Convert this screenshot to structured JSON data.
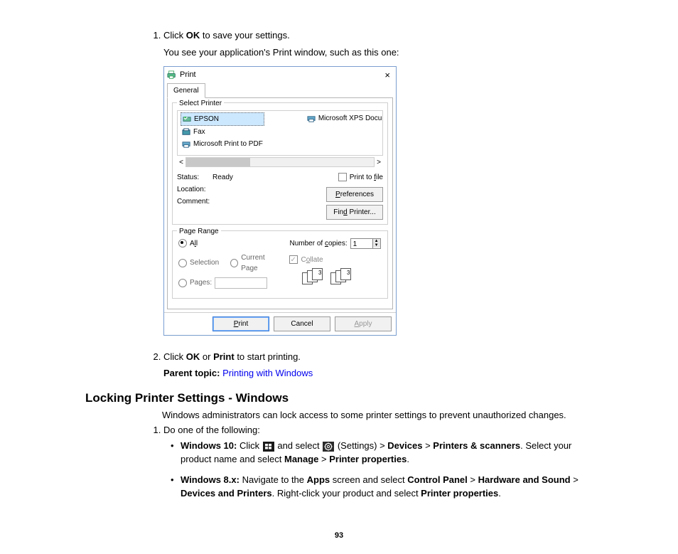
{
  "step1": {
    "num": "1.",
    "text_before": "Click ",
    "text_bold": "OK",
    "text_after": " to save your settings.",
    "subtext": "You see your application's Print window, such as this one:"
  },
  "dialog": {
    "title": "Print",
    "close": "×",
    "tab": "General",
    "group_select": "Select Printer",
    "printers": {
      "p0": "EPSON",
      "p1": "Fax",
      "p2": "Microsoft Print to PDF",
      "p3": "Microsoft XPS Document"
    },
    "scroll_left": "<",
    "scroll_right": ">",
    "status_lbl": "Status:",
    "status_val": "Ready",
    "location_lbl": "Location:",
    "comment_lbl": "Comment:",
    "print_to_file_pre": "Print to ",
    "print_to_file_u": "f",
    "print_to_file_post": "ile",
    "btn_pref_u": "P",
    "btn_pref_post": "references",
    "btn_find_pre": "Fin",
    "btn_find_u": "d",
    "btn_find_post": " Printer...",
    "group_range": "Page Range",
    "radio_all_pre": "A",
    "radio_all_u": "l",
    "radio_all_post": "l",
    "radio_selection": "Selection",
    "radio_current": "Current Page",
    "radio_pages": "Pages:",
    "copies_pre": "Number of ",
    "copies_u": "c",
    "copies_post": "opies:",
    "copies_val": "1",
    "collate_pre": "C",
    "collate_u": "o",
    "collate_post": "llate",
    "footer_print_u": "P",
    "footer_print_post": "rint",
    "footer_cancel": "Cancel",
    "footer_apply_u": "A",
    "footer_apply_post": "pply"
  },
  "step2": {
    "text_before": "Click ",
    "b1": "OK",
    "mid": " or ",
    "b2": "Print",
    "text_after": " to start printing."
  },
  "parent": {
    "label": "Parent topic: ",
    "link": "Printing with Windows"
  },
  "section": {
    "title": "Locking Printer Settings - Windows",
    "intro": "Windows administrators can lock access to some printer settings to prevent unauthorized changes.",
    "step1": "Do one of the following:",
    "win10": {
      "label": "Windows 10:",
      "t1": " Click ",
      "t2": " and select ",
      "t3": " (Settings) > ",
      "b1": "Devices",
      "t4": " > ",
      "b2": "Printers & scanners",
      "t5": ". Select your product name and select ",
      "b3": "Manage",
      "t6": " > ",
      "b4": "Printer properties",
      "t7": "."
    },
    "win8": {
      "label": "Windows 8.x:",
      "t1": " Navigate to the ",
      "b1": "Apps",
      "t2": " screen and select ",
      "b2": "Control Panel",
      "t3": " > ",
      "b3": "Hardware and Sound",
      "t4": " > ",
      "b4": "Devices and Printers",
      "t5": ". Right-click your product and select ",
      "b5": "Printer properties",
      "t6": "."
    }
  },
  "page_number": "93"
}
